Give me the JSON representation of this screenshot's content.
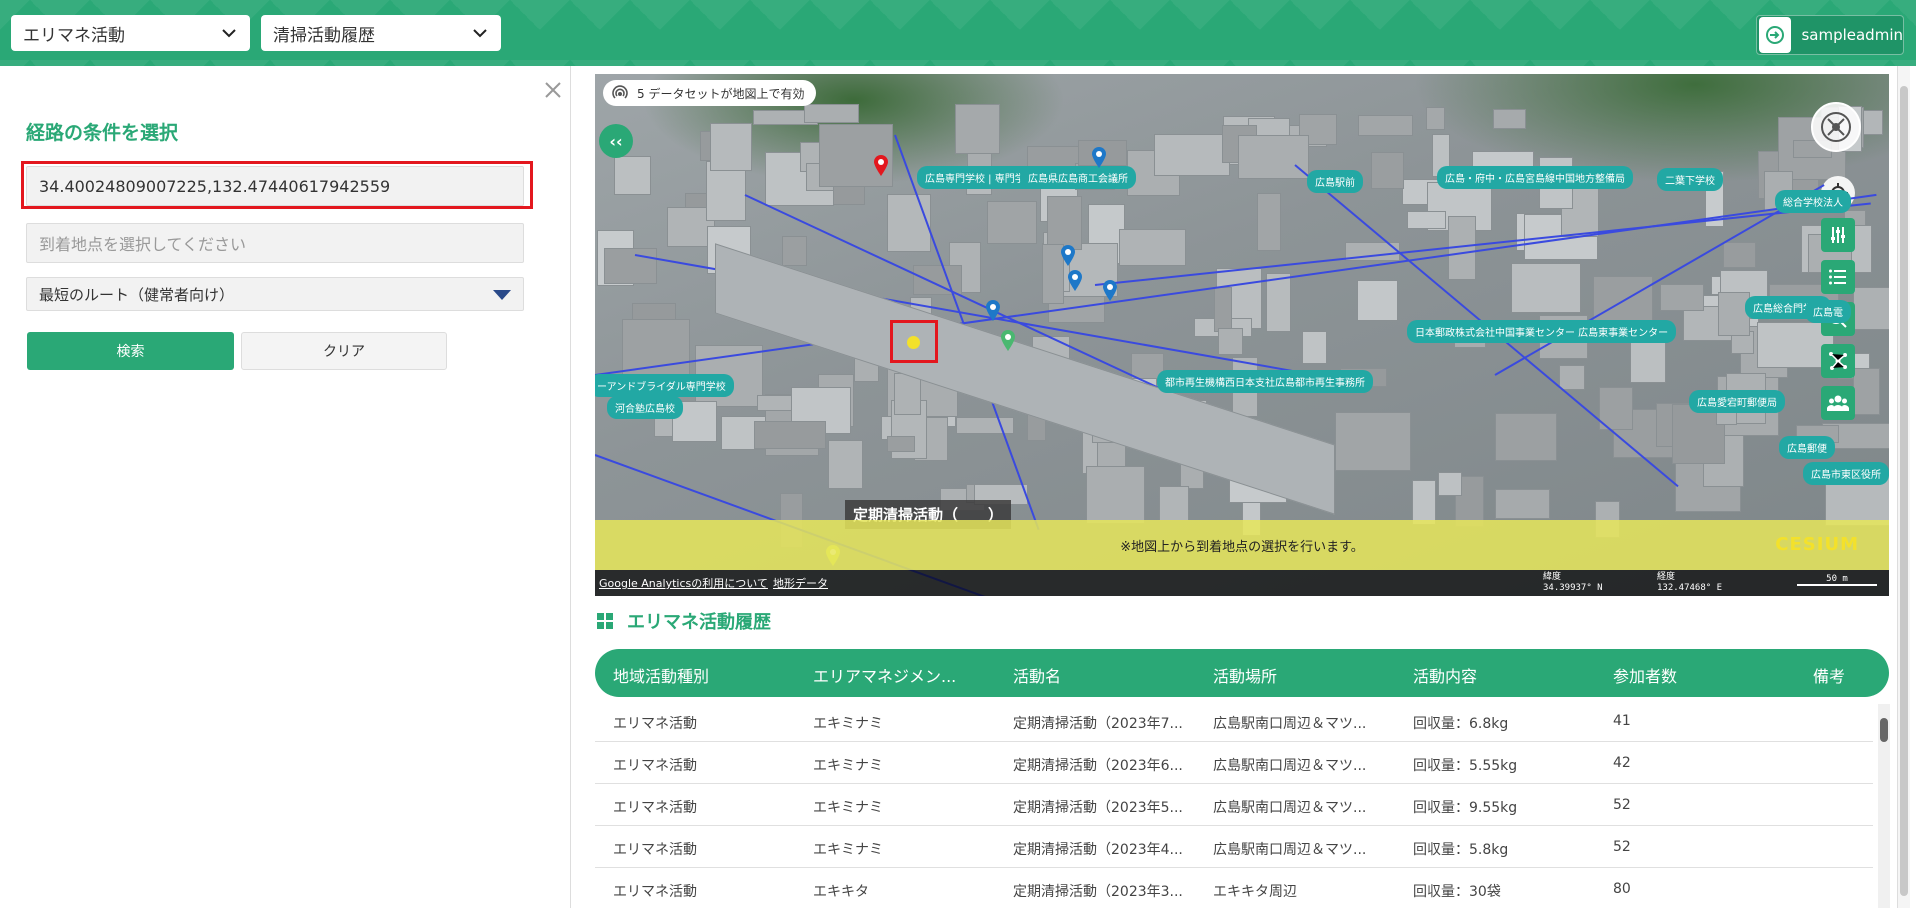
{
  "header": {
    "category_select": "エリマネ活動",
    "page_select": "清掃活動履歴",
    "user_name": "sampleadmin"
  },
  "route_panel": {
    "title": "経路の条件を選択",
    "origin_value": "34.40024809007225,132.47440617942559",
    "destination_placeholder": "到着地点を選択してください",
    "route_type": "最短のルート（健常者向け）",
    "search_label": "検索",
    "clear_label": "クリア"
  },
  "map": {
    "dataset_badge": "5 データセットが地図上で有効",
    "notice": "※地図上から到着地点の選択を行います。",
    "cesium": "CESIUM",
    "footer_link_analytics": "Google Analyticsの利用について",
    "footer_link_terrain": "地形データ",
    "latitude_label": "緯度",
    "latitude_value": "34.39937° N",
    "longitude_label": "経度",
    "longitude_value": "132.47468° E",
    "scale": "50 m",
    "marker_label": "定期清掃活動（　　）",
    "labels": [
      "広島専門学校 | 専門学校",
      "広島県広島商工会議所",
      "広島駅前",
      "広島・府中・広島宮島線中国地方整備局",
      "二葉下学校",
      "総合学校法人",
      "日本郵政株式会社中国事業センター 広島東事業センター",
      "都市再生機構西日本支社広島都市再生事務所",
      "ーアンドブライダル専門学校",
      "河合塾広島校",
      "広島郵便",
      "広島愛宕町郵便局",
      "広島市東区役所",
      "広島総合門学校",
      "広島電"
    ]
  },
  "history": {
    "title": "エリマネ活動履歴",
    "columns": [
      "地域活動種別",
      "エリアマネジメン...",
      "活動名",
      "活動場所",
      "活動内容",
      "参加者数",
      "備考"
    ],
    "rows": [
      [
        "エリマネ活動",
        "エキミナミ",
        "定期清掃活動（2023年7...",
        "広島駅南口周辺＆マツ...",
        "回収量：6.8kg",
        "41",
        ""
      ],
      [
        "エリマネ活動",
        "エキミナミ",
        "定期清掃活動（2023年6...",
        "広島駅南口周辺＆マツ...",
        "回収量：5.55kg",
        "42",
        ""
      ],
      [
        "エリマネ活動",
        "エキミナミ",
        "定期清掃活動（2023年5...",
        "広島駅南口周辺＆マツ...",
        "回収量：9.55kg",
        "52",
        ""
      ],
      [
        "エリマネ活動",
        "エキミナミ",
        "定期清掃活動（2023年4...",
        "広島駅南口周辺＆マツ...",
        "回収量：5.8kg",
        "52",
        ""
      ],
      [
        "エリマネ活動",
        "エキキタ",
        "定期清掃活動（2023年3...",
        "エキキタ周辺",
        "回収量：30袋",
        "80",
        ""
      ]
    ]
  },
  "colors": {
    "brand": "#2aa876",
    "highlight": "#e3171e",
    "label_teal": "#22a8a4"
  }
}
